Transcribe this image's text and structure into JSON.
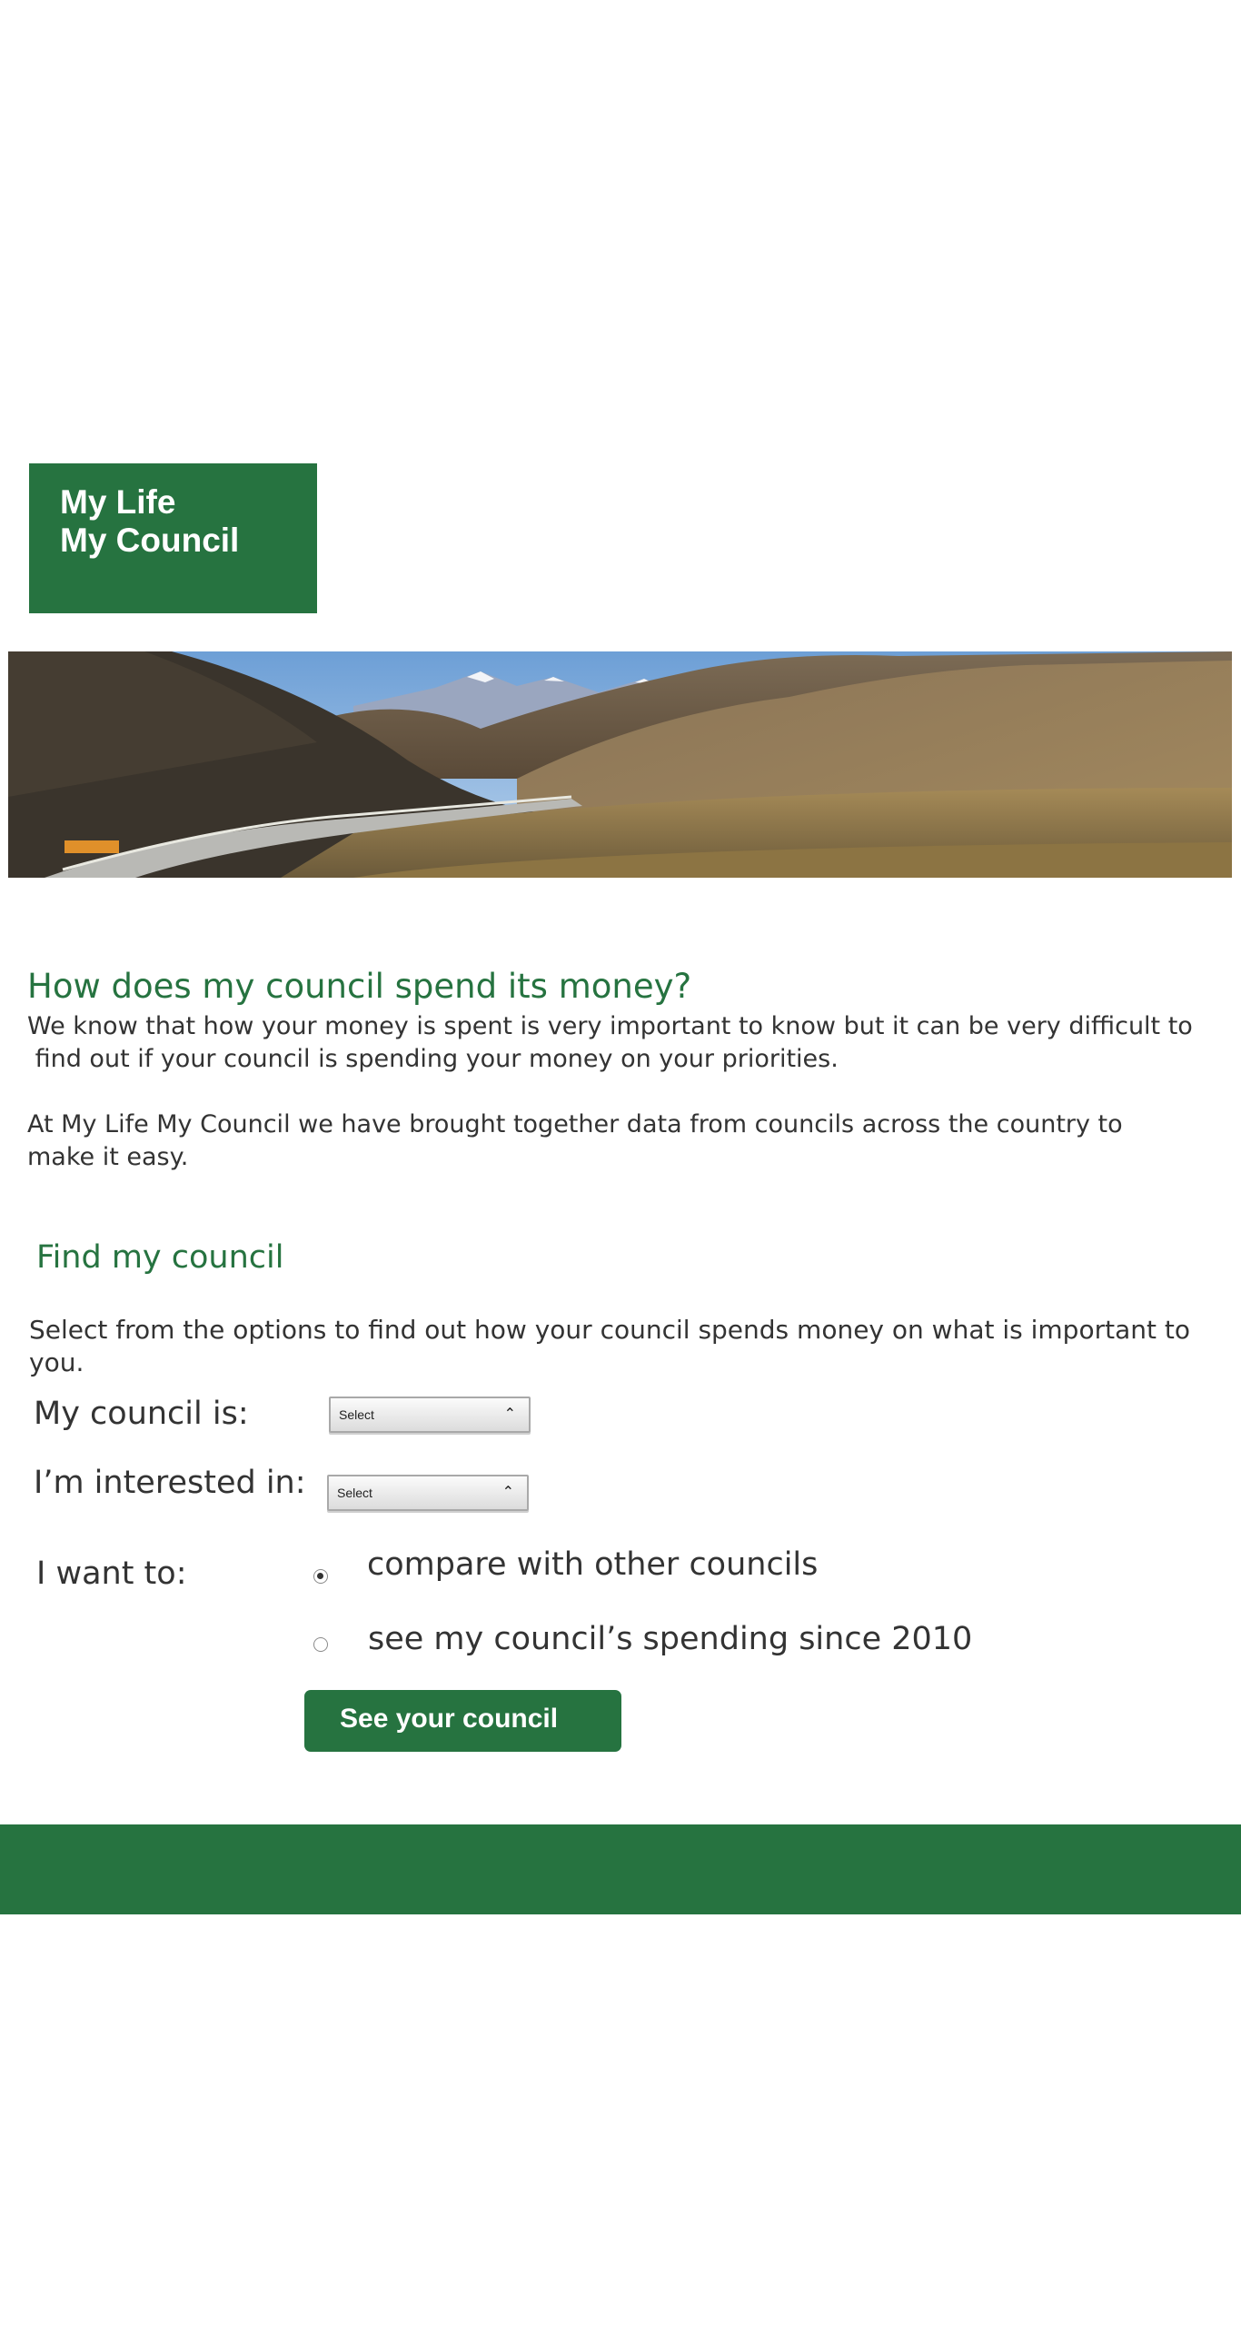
{
  "logo": {
    "line1": "My Life",
    "line2": "My Council"
  },
  "intro": {
    "heading": "How does my council spend its money?",
    "paragraph1_line1": "We know that how your money is spent is very important to know but it can be very difficult to",
    "paragraph1_line2": " find out if your council is spending your money on your priorities.",
    "paragraph2_line1": "At My Life My Council we have brought together data from councils across the country to",
    "paragraph2_line2": "make it easy."
  },
  "finder": {
    "heading": "Find my council",
    "description": "Select from the options to find out how your council spends money on what is important to you.",
    "council_label": "My council is:",
    "council_select": "Select",
    "interest_label": "I’m interested in:",
    "interest_select": "Select",
    "want_label": "I want to:",
    "options": [
      {
        "label": "compare with other councils",
        "checked": true
      },
      {
        "label": "see my council’s spending since 2010",
        "checked": false
      }
    ],
    "button_label": "See your council"
  },
  "colors": {
    "brand_green": "#267340",
    "text": "#333333",
    "background": "#ffffff"
  },
  "icons": {
    "select_caret": "chevron-up-icon",
    "hero": "mountain-landscape-image"
  }
}
